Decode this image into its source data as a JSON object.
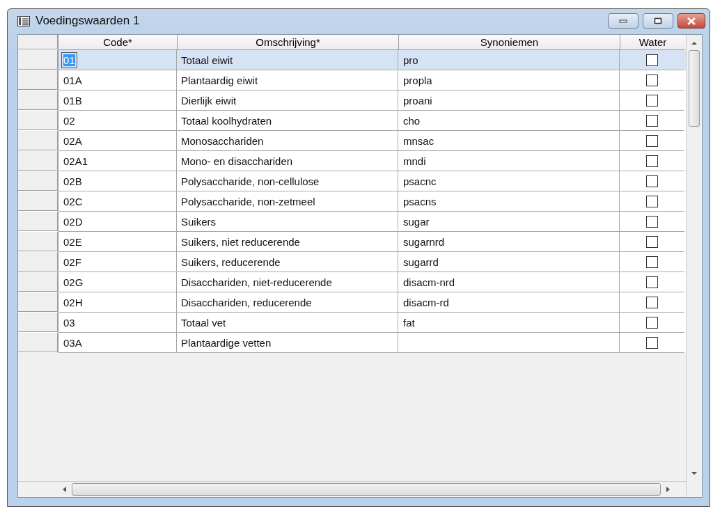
{
  "window": {
    "title": "Voedingswaarden 1"
  },
  "table": {
    "columns": [
      "Code*",
      "Omschrijving*",
      "Synoniemen",
      "Water"
    ],
    "rows": [
      {
        "code": "01",
        "description": "Totaal eiwit",
        "synonym": "pro",
        "water": false,
        "selected": true
      },
      {
        "code": "01A",
        "description": "Plantaardig eiwit",
        "synonym": "propla",
        "water": false,
        "selected": false
      },
      {
        "code": "01B",
        "description": "Dierlijk eiwit",
        "synonym": "proani",
        "water": false,
        "selected": false
      },
      {
        "code": "02",
        "description": "Totaal koolhydraten",
        "synonym": "cho",
        "water": false,
        "selected": false
      },
      {
        "code": "02A",
        "description": "Monosacchariden",
        "synonym": "mnsac",
        "water": false,
        "selected": false
      },
      {
        "code": "02A1",
        "description": "Mono- en disacchariden",
        "synonym": "mndi",
        "water": false,
        "selected": false
      },
      {
        "code": "02B",
        "description": "Polysaccharide, non-cellulose",
        "synonym": "psacnc",
        "water": false,
        "selected": false
      },
      {
        "code": "02C",
        "description": "Polysaccharide, non-zetmeel",
        "synonym": "psacns",
        "water": false,
        "selected": false
      },
      {
        "code": "02D",
        "description": "Suikers",
        "synonym": "sugar",
        "water": false,
        "selected": false
      },
      {
        "code": "02E",
        "description": "Suikers, niet reducerende",
        "synonym": "sugarnrd",
        "water": false,
        "selected": false
      },
      {
        "code": "02F",
        "description": "Suikers, reducerende",
        "synonym": "sugarrd",
        "water": false,
        "selected": false
      },
      {
        "code": "02G",
        "description": "Disacchariden, niet-reducerende",
        "synonym": "disacm-nrd",
        "water": false,
        "selected": false
      },
      {
        "code": "02H",
        "description": "Disacchariden, reducerende",
        "synonym": "disacm-rd",
        "water": false,
        "selected": false
      },
      {
        "code": "03",
        "description": "Totaal vet",
        "synonym": "fat",
        "water": false,
        "selected": false
      },
      {
        "code": "03A",
        "description": "Plantaardige vetten",
        "water": false,
        "selected": false
      }
    ]
  }
}
